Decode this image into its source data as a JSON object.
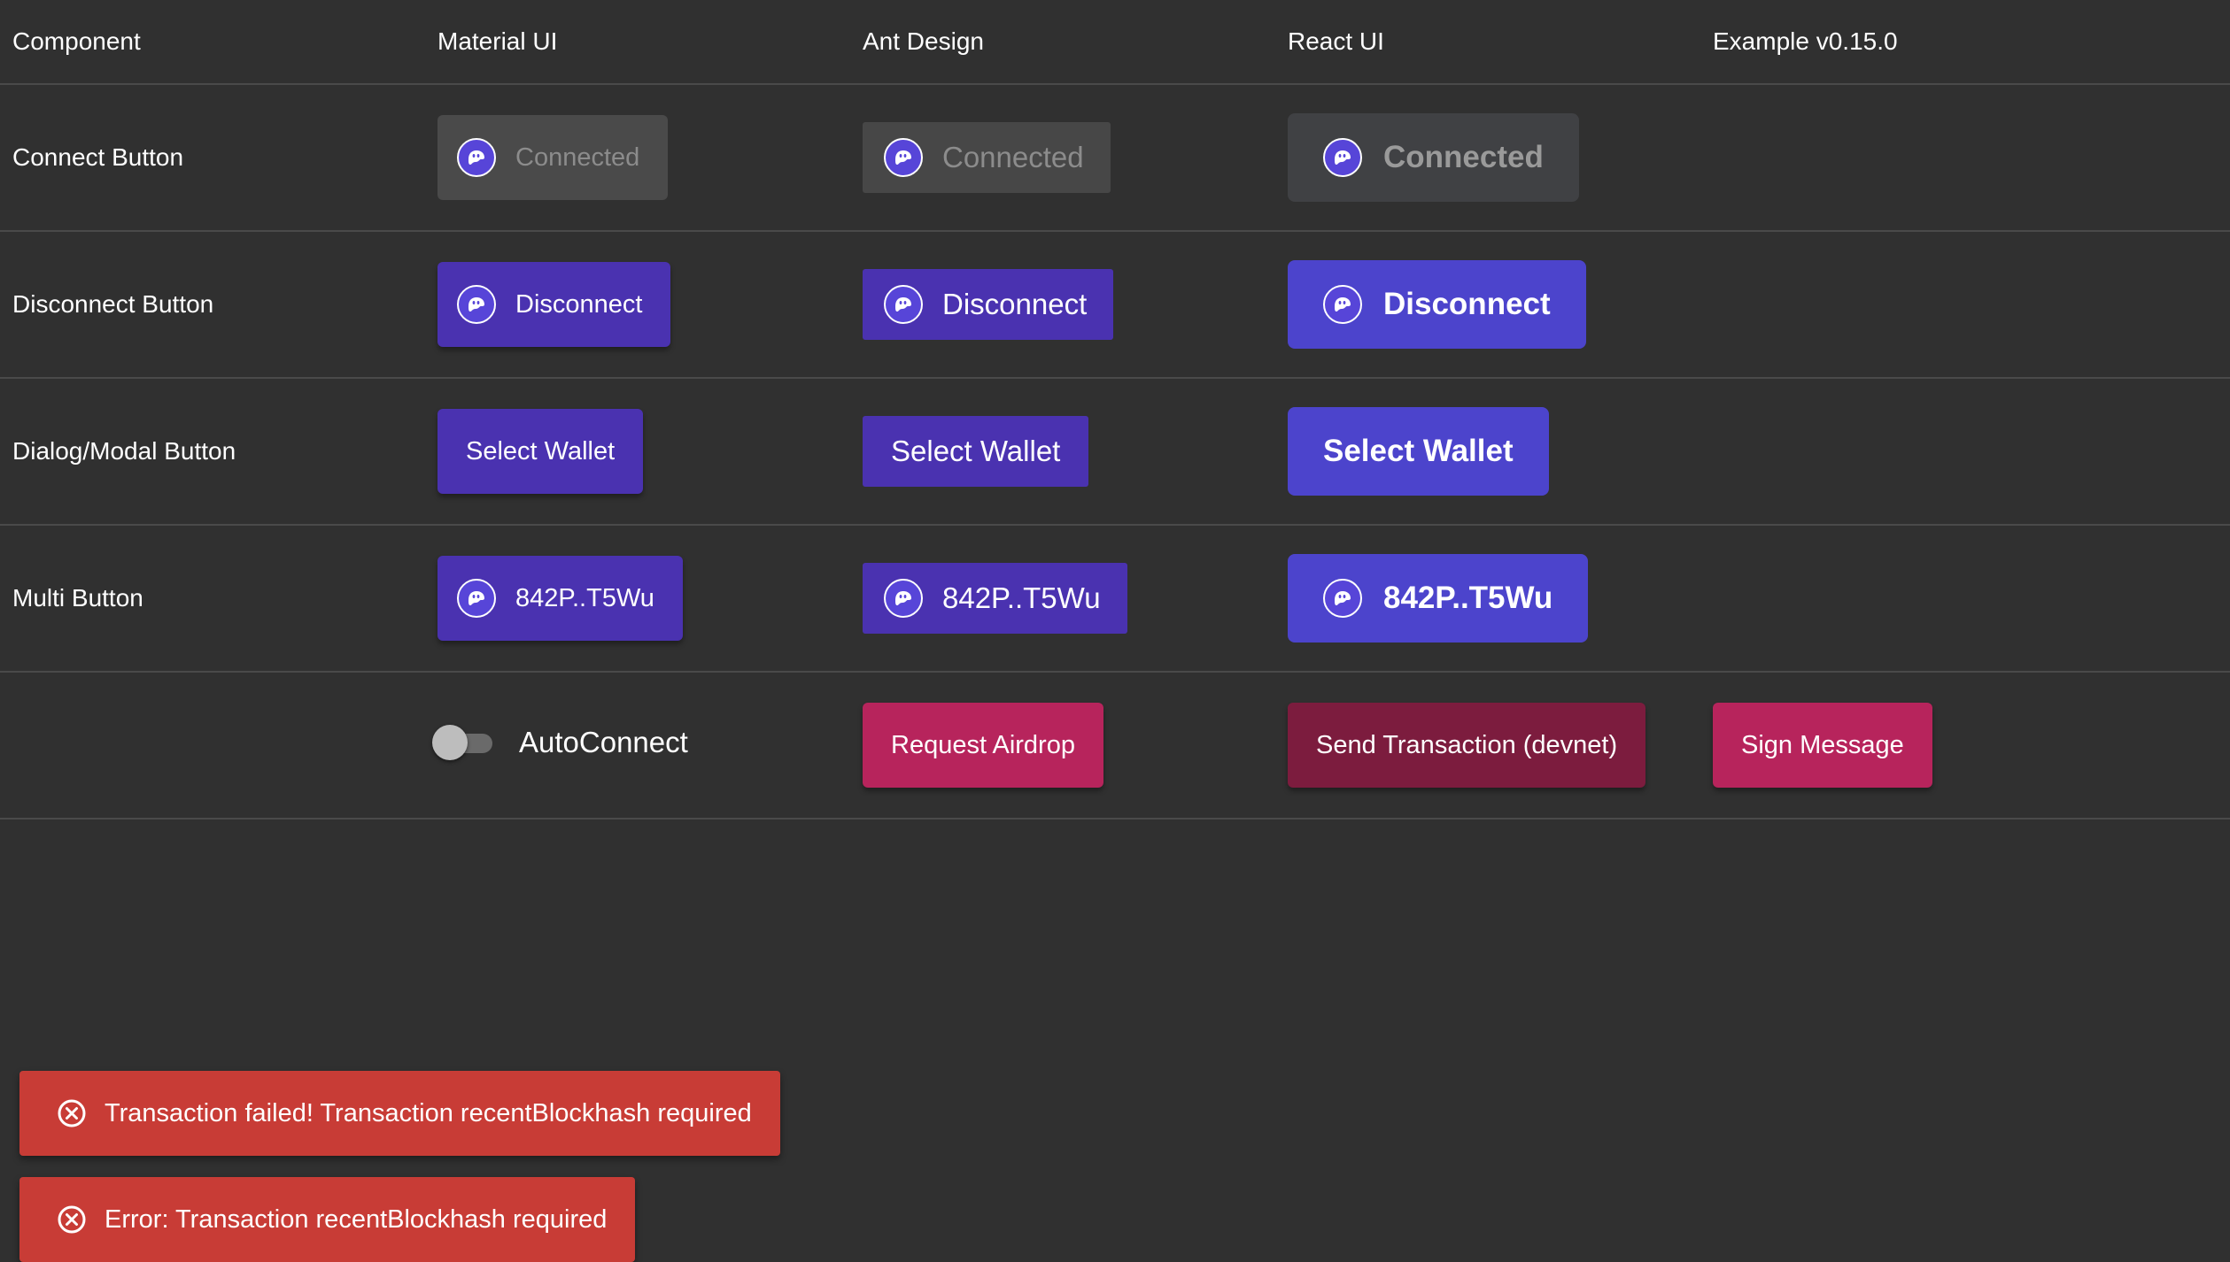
{
  "header": {
    "component": "Component",
    "material_ui": "Material UI",
    "ant_design": "Ant Design",
    "react_ui": "React UI",
    "example": "Example v0.15.0"
  },
  "rows": {
    "connect": {
      "label": "Connect Button",
      "mui": "Connected",
      "ant": "Connected",
      "rui": "Connected"
    },
    "disconnect": {
      "label": "Disconnect Button",
      "mui": "Disconnect",
      "ant": "Disconnect",
      "rui": "Disconnect"
    },
    "dialog": {
      "label": "Dialog/Modal Button",
      "mui": "Select Wallet",
      "ant": "Select Wallet",
      "rui": "Select Wallet"
    },
    "multi": {
      "label": "Multi Button",
      "mui": "842P..T5Wu",
      "ant": "842P..T5Wu",
      "rui": "842P..T5Wu"
    },
    "actions": {
      "autoconnect_label": "AutoConnect",
      "autoconnect_on": false,
      "request_airdrop": "Request Airdrop",
      "send_transaction": "Send Transaction (devnet)",
      "sign_message": "Sign Message"
    }
  },
  "notifications": [
    {
      "text": "Transaction failed! Transaction recentBlockhash required",
      "icon": "error-circle-icon"
    },
    {
      "text": "Error: Transaction recentBlockhash required",
      "icon": "error-circle-icon"
    }
  ],
  "colors": {
    "background": "#303030",
    "wallet_purple": "#4a32b0",
    "react_ui_blue": "#4c44cc",
    "action_pink": "#b7245c",
    "action_pink_dark": "#7c1c3e",
    "error_red": "#c83c36"
  },
  "icons": {
    "wallet": "phantom-wallet-icon"
  }
}
